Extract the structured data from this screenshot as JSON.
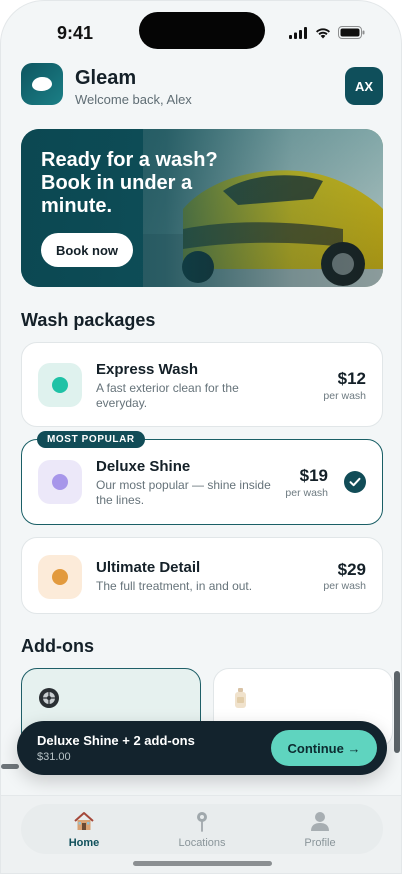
{
  "status": {
    "time": "9:41"
  },
  "header": {
    "brand": "Gleam",
    "welcome": "Welcome back, Alex",
    "avatar": "AX"
  },
  "hero": {
    "title": "Ready for a wash? Book in under a minute.",
    "button": "Book now"
  },
  "packages": {
    "title": "Wash packages",
    "badge": "MOST POPULAR",
    "items": [
      {
        "name": "Express Wash",
        "desc": "A fast exterior clean for the everyday.",
        "price": "$12",
        "unit": "per wash",
        "color": "#1fc2a6",
        "bg": "#dff2ee",
        "selected": false
      },
      {
        "name": "Deluxe Shine",
        "desc": "Our most popular — shine inside the lines.",
        "price": "$19",
        "unit": "per wash",
        "color": "#a796ea",
        "bg": "#ece8f9",
        "selected": true
      },
      {
        "name": "Ultimate Detail",
        "desc": "The full treatment, in and out.",
        "price": "$29",
        "unit": "per wash",
        "color": "#e29a3e",
        "bg": "#fcebd9",
        "selected": false
      }
    ]
  },
  "addons": {
    "title": "Add-ons",
    "icons": [
      "wheel-icon",
      "bottle-icon"
    ]
  },
  "summary": {
    "title": "Deluxe Shine + 2 add-ons",
    "total": "$31.00",
    "button": "Continue →"
  },
  "tabs": [
    {
      "label": "Home",
      "icon": "home-icon",
      "active": true
    },
    {
      "label": "Locations",
      "icon": "pin-icon",
      "active": false
    },
    {
      "label": "Profile",
      "icon": "profile-icon",
      "active": false
    }
  ],
  "colors": {
    "brand": "#114c57",
    "accent": "#5fd4bf",
    "dark": "#13232d"
  }
}
